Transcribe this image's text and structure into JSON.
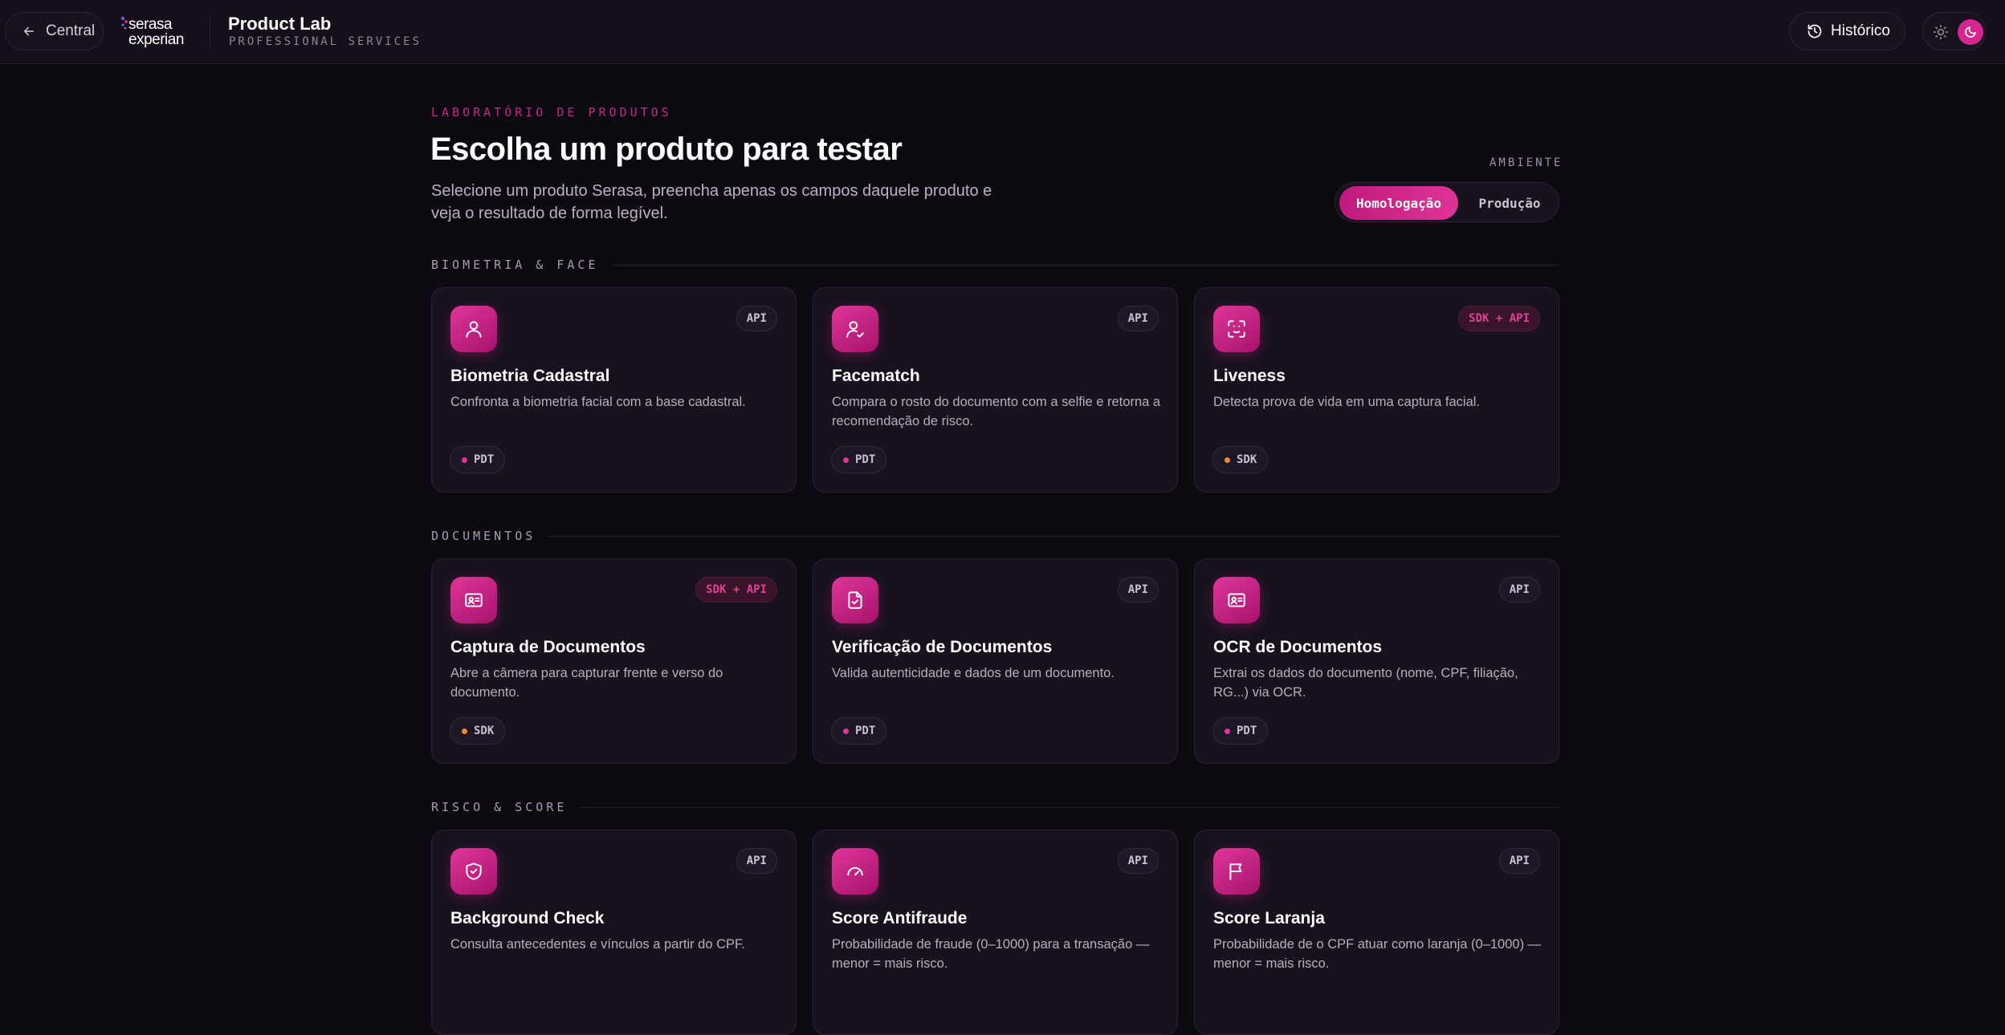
{
  "header": {
    "back_label": "Central",
    "logo_line1": "serasa",
    "logo_line2": "experian",
    "app_title": "Product Lab",
    "app_subtitle": "PROFESSIONAL SERVICES",
    "history_label": "Histórico"
  },
  "hero": {
    "eyebrow": "LABORATÓRIO DE PRODUTOS",
    "title": "Escolha um produto para testar",
    "description": "Selecione um produto Serasa, preencha apenas os campos daquele produto e veja o resultado de forma legível."
  },
  "environment": {
    "label": "AMBIENTE",
    "options": [
      "Homologação",
      "Produção"
    ],
    "selected": "Homologação"
  },
  "colors": {
    "accent": "#d6258e",
    "dot_pdt": "#e0359a",
    "dot_sdk": "#f08a2c"
  },
  "sections": [
    {
      "title": "BIOMETRIA & FACE",
      "cards": [
        {
          "icon": "user-icon",
          "badge": "API",
          "title": "Biometria Cadastral",
          "desc": "Confronta a biometria facial com a base cadastral.",
          "tag": "PDT"
        },
        {
          "icon": "user-check-icon",
          "badge": "API",
          "title": "Facematch",
          "desc": "Compara o rosto do documento com a selfie e retorna a recomendação de risco.",
          "tag": "PDT"
        },
        {
          "icon": "face-scan-icon",
          "badge": "SDK + API",
          "title": "Liveness",
          "desc": "Detecta prova de vida em uma captura facial.",
          "tag": "SDK"
        }
      ]
    },
    {
      "title": "DOCUMENTOS",
      "cards": [
        {
          "icon": "id-card-icon",
          "badge": "SDK + API",
          "title": "Captura de Documentos",
          "desc": "Abre a câmera para capturar frente e verso do documento.",
          "tag": "SDK"
        },
        {
          "icon": "file-check-icon",
          "badge": "API",
          "title": "Verificação de Documentos",
          "desc": "Valida autenticidade e dados de um documento.",
          "tag": "PDT"
        },
        {
          "icon": "id-card-icon",
          "badge": "API",
          "title": "OCR de Documentos",
          "desc": "Extrai os dados do documento (nome, CPF, filiação, RG...) via OCR.",
          "tag": "PDT"
        }
      ]
    },
    {
      "title": "RISCO & SCORE",
      "cards": [
        {
          "icon": "shield-check-icon",
          "badge": "API",
          "title": "Background Check",
          "desc": "Consulta antecedentes e vínculos a partir do CPF.",
          "tag": ""
        },
        {
          "icon": "gauge-icon",
          "badge": "API",
          "title": "Score Antifraude",
          "desc": "Probabilidade de fraude (0–1000) para a transação — menor = mais risco.",
          "tag": ""
        },
        {
          "icon": "flag-icon",
          "badge": "API",
          "title": "Score Laranja",
          "desc": "Probabilidade de o CPF atuar como laranja (0–1000) — menor = mais risco.",
          "tag": ""
        }
      ]
    }
  ]
}
